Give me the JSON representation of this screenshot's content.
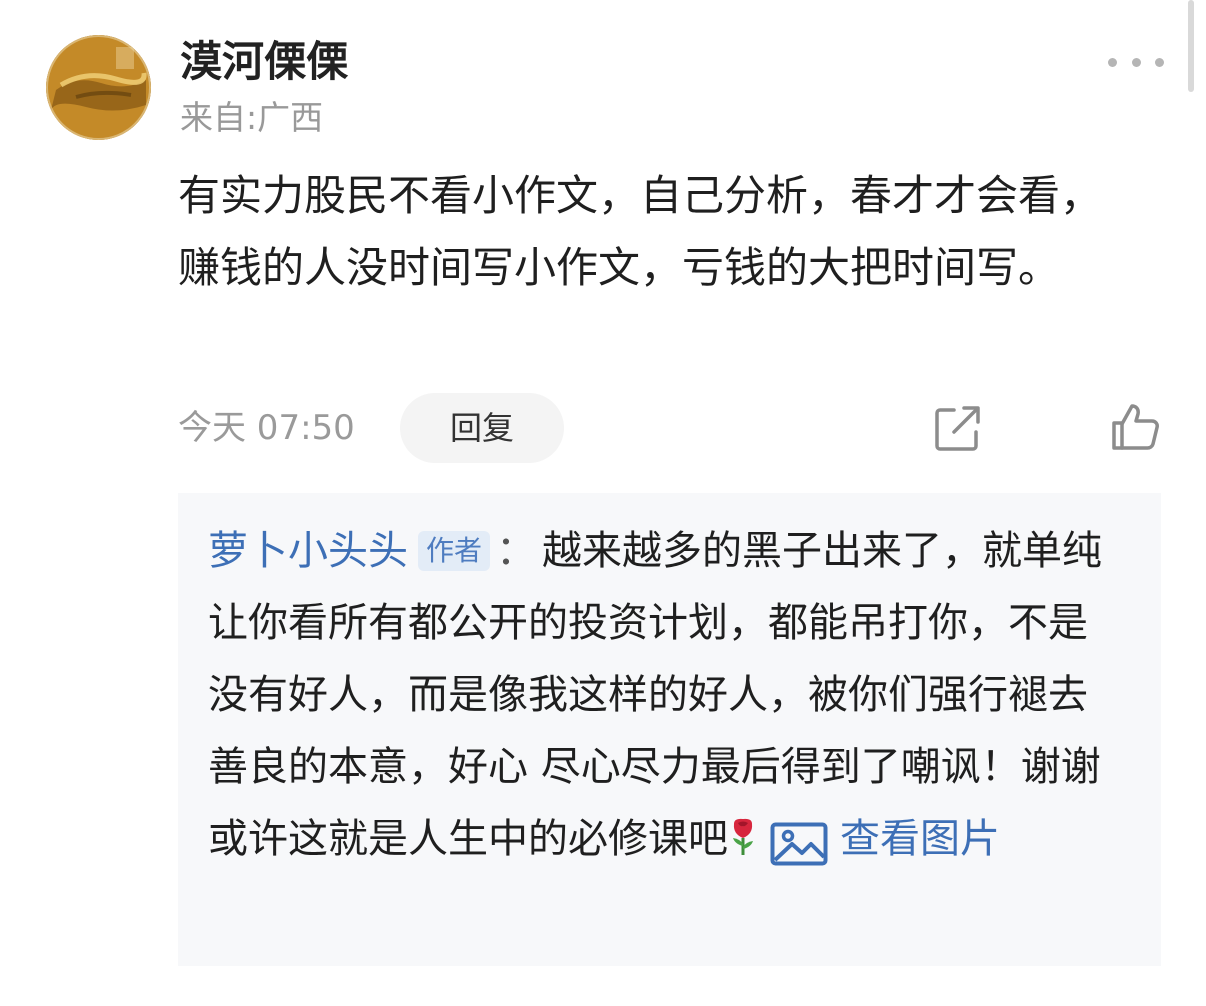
{
  "comment": {
    "username": "漠河傈傈",
    "location": "来自:广西",
    "body": "有实力股民不看小作文，自己分析，春才才会看，赚钱的人没时间写小作文，亏钱的大把时间写。",
    "time": "今天 07:50",
    "reply_label": "回复",
    "icons": {
      "more": "more-dots-icon",
      "share": "share-icon",
      "like": "thumbs-up-icon",
      "avatar": "avatar-image"
    }
  },
  "reply": {
    "author": "萝卜小头头",
    "badge": "作者",
    "separator": "：",
    "text": "越来越多的黑子出来了，就单纯让你看所有都公开的投资计划，都能吊打你，不是没有好人，而是像我这样的好人，被你们强行褪去善良的本意，好心 尽心尽力最后得到了嘲讽！谢谢 或许这就是人生中的必修课吧",
    "emoji": "rose-emoji",
    "view_image_label": "查看图片",
    "image_icon": "image-icon"
  },
  "colors": {
    "link": "#3d6fb6",
    "badge_bg": "#e3ecf7",
    "reply_bg": "#f7f8fa",
    "meta": "#999999"
  }
}
